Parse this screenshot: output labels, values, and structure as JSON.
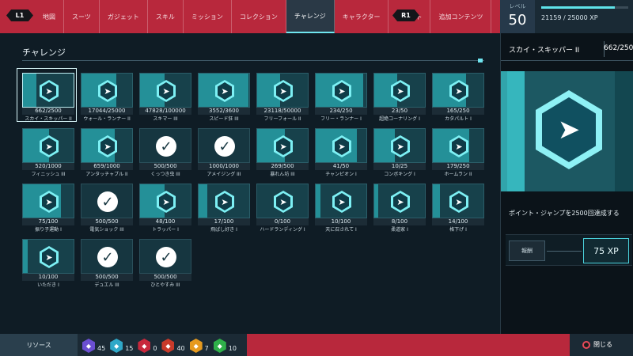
{
  "nav": {
    "l1": "L1",
    "r1": "R1",
    "tabs": [
      {
        "label": "地図"
      },
      {
        "label": "スーツ"
      },
      {
        "label": "ガジェット"
      },
      {
        "label": "スキル"
      },
      {
        "label": "ミッション"
      },
      {
        "label": "コレクション"
      },
      {
        "label": "チャレンジ"
      },
      {
        "label": "キャラクター"
      },
      {
        "label": "祖リスト"
      },
      {
        "label": "追加コンテンツ"
      }
    ],
    "active_tab": "チャレンジ"
  },
  "level": {
    "label": "レベル",
    "value": "50",
    "xp_text": "21159 / 25000 XP",
    "xp_fraction": 0.846
  },
  "section_title": "チャレンジ",
  "challenges": [
    {
      "name": "スカイ・スキッパー II",
      "progress": "662/2500",
      "fraction": 0.26,
      "status": "progress"
    },
    {
      "name": "ウォール・ランナー II",
      "progress": "17044/25000",
      "fraction": 0.68,
      "status": "progress"
    },
    {
      "name": "スキマー III",
      "progress": "47828/100000",
      "fraction": 0.48,
      "status": "progress"
    },
    {
      "name": "スピード狂 III",
      "progress": "3552/3600",
      "fraction": 0.99,
      "status": "progress"
    },
    {
      "name": "フリーフォール II",
      "progress": "23118/50000",
      "fraction": 0.46,
      "status": "progress"
    },
    {
      "name": "フリー・ランナー I",
      "progress": "234/250",
      "fraction": 0.94,
      "status": "progress"
    },
    {
      "name": "超絶コーナリング I",
      "progress": "23/50",
      "fraction": 0.46,
      "status": "progress"
    },
    {
      "name": "カタパルト I",
      "progress": "165/250",
      "fraction": 0.66,
      "status": "progress"
    },
    {
      "name": "フィニッシュ III",
      "progress": "520/1000",
      "fraction": 0.52,
      "status": "progress"
    },
    {
      "name": "アンタッチャブル II",
      "progress": "659/1000",
      "fraction": 0.66,
      "status": "progress"
    },
    {
      "name": "くっつき虫 III",
      "progress": "500/500",
      "fraction": 1,
      "status": "complete"
    },
    {
      "name": "アメイジング III",
      "progress": "1000/1000",
      "fraction": 1,
      "status": "complete"
    },
    {
      "name": "暴れん坊 III",
      "progress": "269/500",
      "fraction": 0.54,
      "status": "progress"
    },
    {
      "name": "チャンピオン I",
      "progress": "41/50",
      "fraction": 0.82,
      "status": "progress"
    },
    {
      "name": "コンボキング I",
      "progress": "10/25",
      "fraction": 0.4,
      "status": "progress"
    },
    {
      "name": "ホームラン II",
      "progress": "179/250",
      "fraction": 0.72,
      "status": "progress"
    },
    {
      "name": "振り子運動 I",
      "progress": "75/100",
      "fraction": 0.75,
      "status": "progress"
    },
    {
      "name": "電気ショック III",
      "progress": "500/500",
      "fraction": 1,
      "status": "complete"
    },
    {
      "name": "トラッパー I",
      "progress": "48/100",
      "fraction": 0.48,
      "status": "progress"
    },
    {
      "name": "飛ばし好き I",
      "progress": "17/100",
      "fraction": 0.17,
      "status": "progress"
    },
    {
      "name": "ハードランディング I",
      "progress": "0/100",
      "fraction": 0,
      "status": "progress"
    },
    {
      "name": "天に召されて I",
      "progress": "10/100",
      "fraction": 0.1,
      "status": "progress"
    },
    {
      "name": "柔道家 I",
      "progress": "8/100",
      "fraction": 0.08,
      "status": "progress"
    },
    {
      "name": "格下げ I",
      "progress": "14/100",
      "fraction": 0.14,
      "status": "progress"
    },
    {
      "name": "いただき I",
      "progress": "10/100",
      "fraction": 0.1,
      "status": "progress"
    },
    {
      "name": "デュエル III",
      "progress": "500/500",
      "fraction": 1,
      "status": "complete"
    },
    {
      "name": "ひとやすみ III",
      "progress": "500/500",
      "fraction": 1,
      "status": "complete"
    }
  ],
  "detail": {
    "name": "スカイ・スキッパー II",
    "progress": "662/2500",
    "description": "ポイント・ジャンプを2500回達成する",
    "reward_label": "報酬",
    "reward_value": "75 XP"
  },
  "bottom": {
    "resources_label": "リソース",
    "resources": [
      {
        "icon": "backpack-token-icon",
        "color": "#6b4fd1",
        "value": "45"
      },
      {
        "icon": "landmark-token-icon",
        "color": "#2fa8c8",
        "value": "15"
      },
      {
        "icon": "base-token-icon",
        "color": "#c8283c",
        "value": "0"
      },
      {
        "icon": "crime-token-icon",
        "color": "#c83a2a",
        "value": "40"
      },
      {
        "icon": "challenge-token-icon",
        "color": "#e69a1e",
        "value": "7"
      },
      {
        "icon": "research-token-icon",
        "color": "#2fb04a",
        "value": "10"
      }
    ],
    "close_label": "閉じる"
  }
}
